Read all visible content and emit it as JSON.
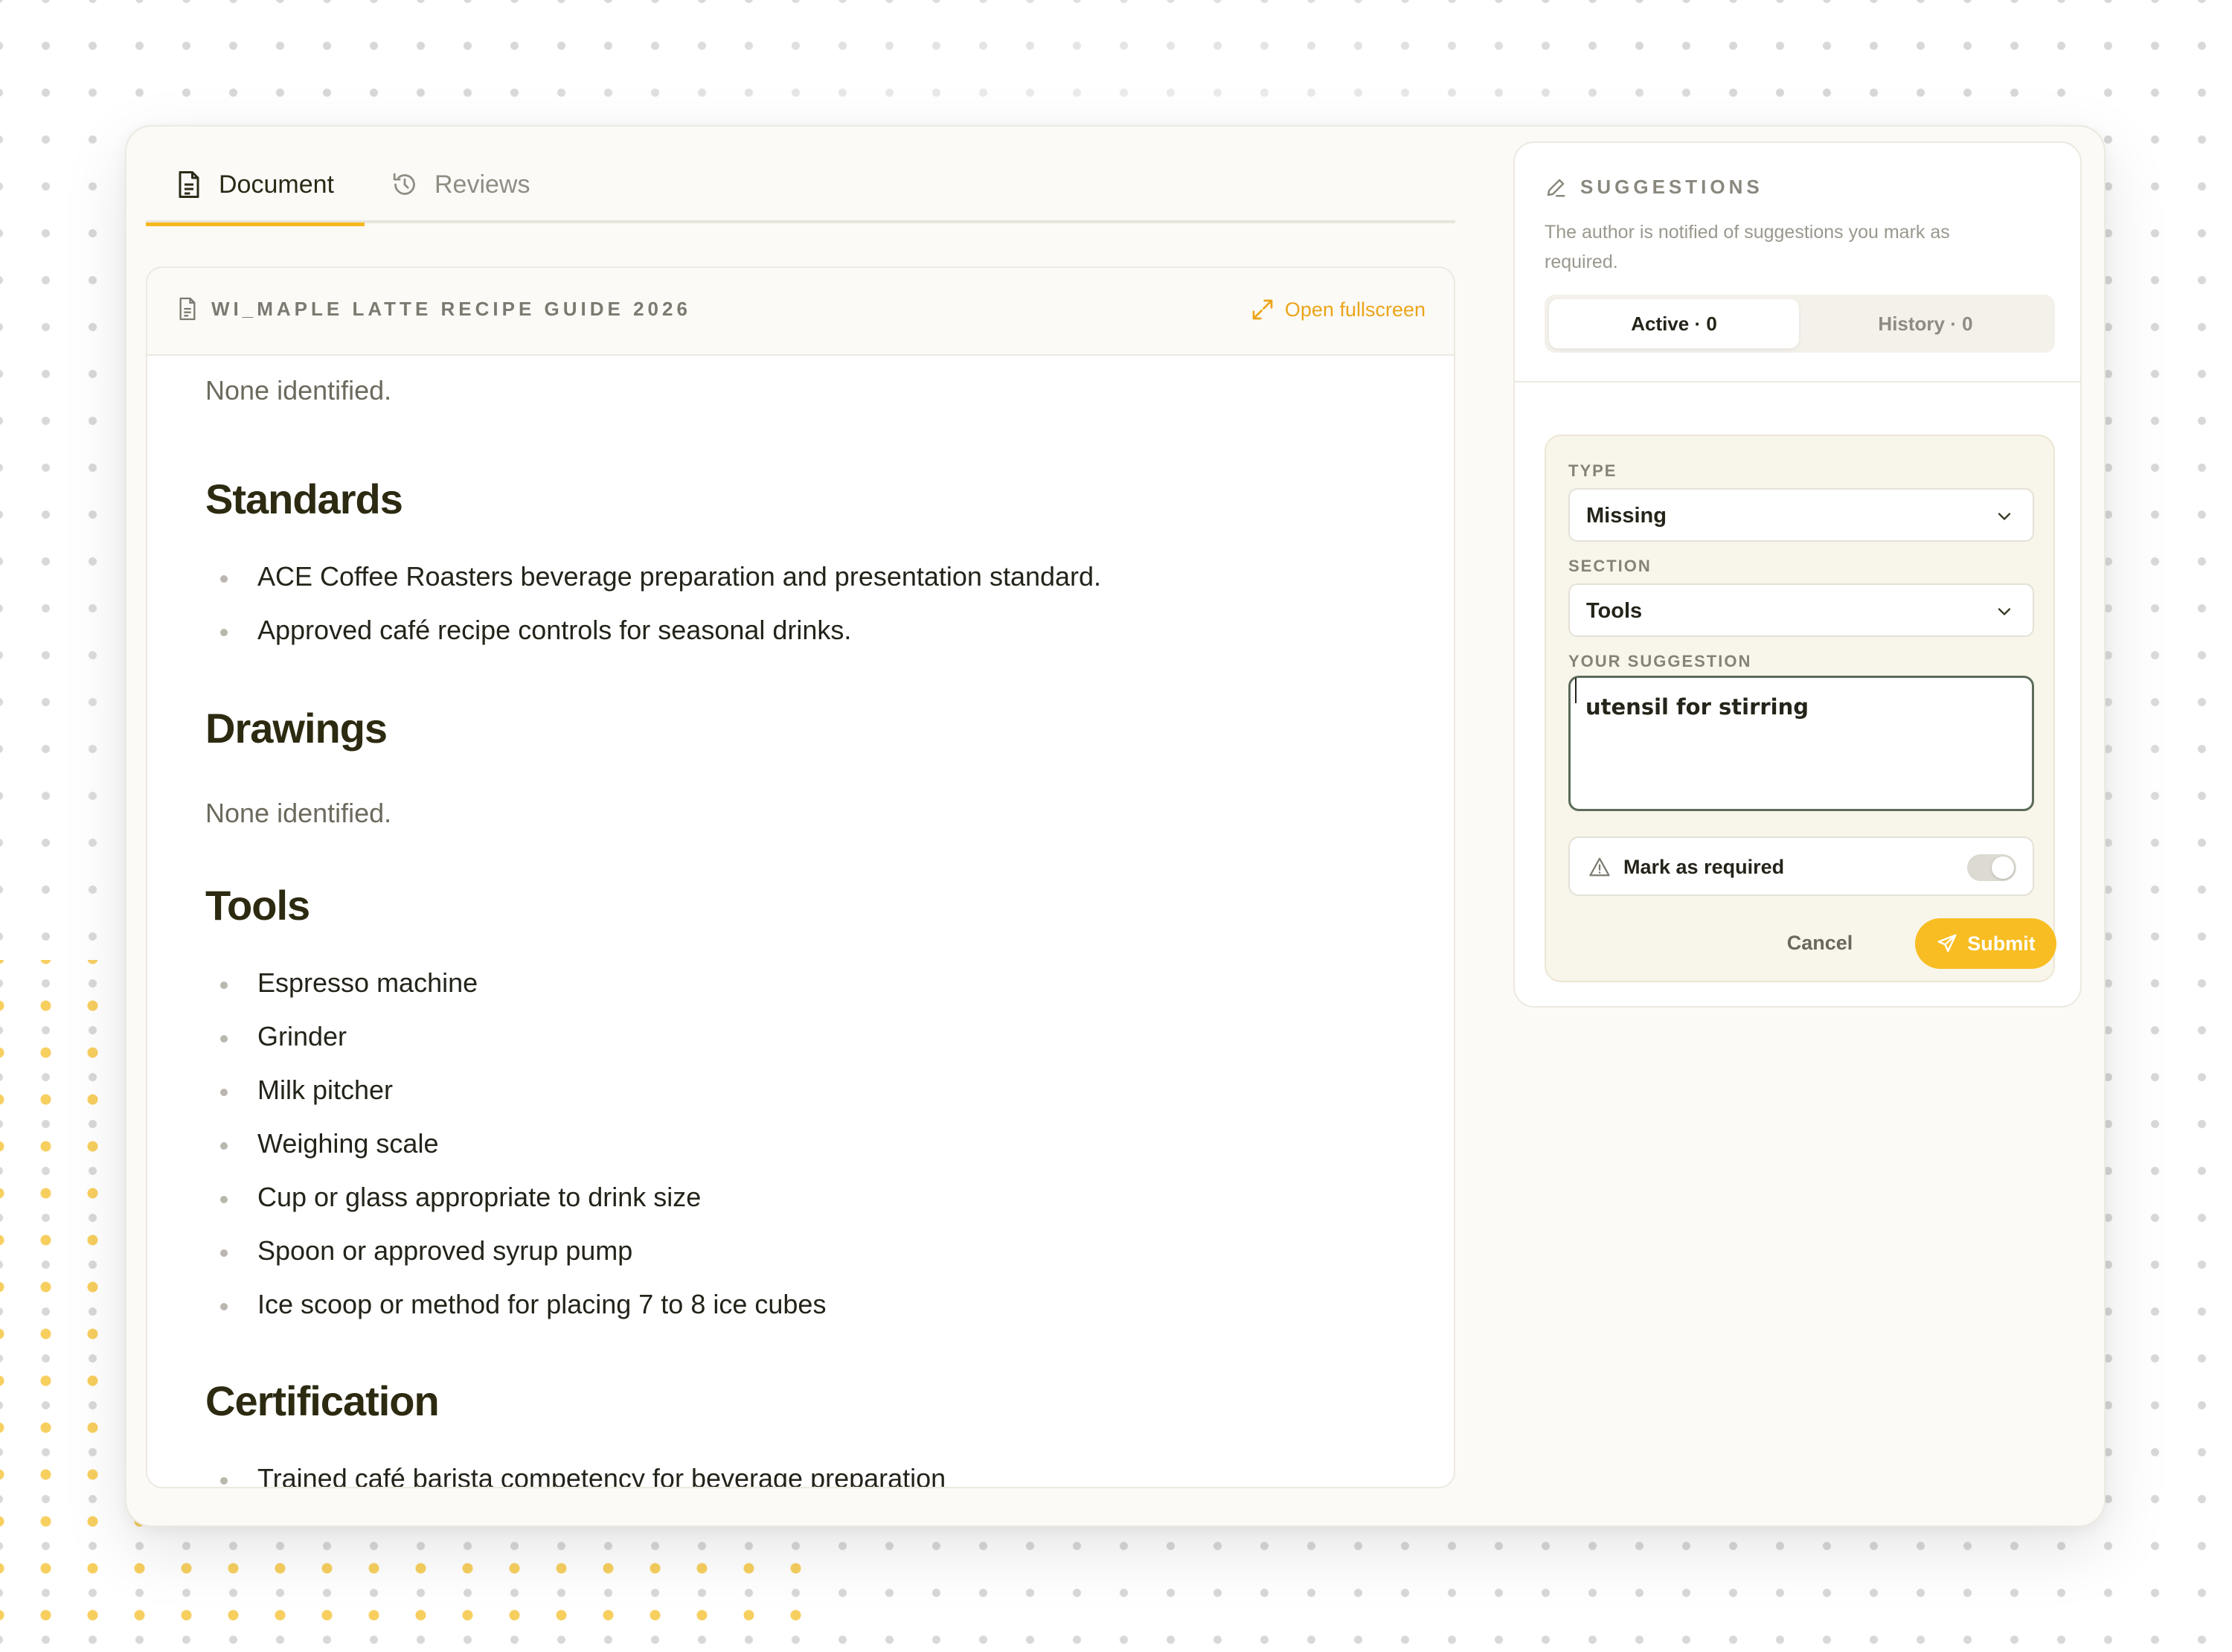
{
  "tabs": {
    "document": "Document",
    "reviews": "Reviews"
  },
  "document": {
    "title": "WI_MAPLE LATTE RECIPE GUIDE 2026",
    "open_fullscreen": "Open fullscreen",
    "intro": "None identified.",
    "standards": {
      "heading": "Standards",
      "items": [
        "ACE Coffee Roasters beverage preparation and presentation standard.",
        "Approved café recipe controls for seasonal drinks."
      ]
    },
    "drawings": {
      "heading": "Drawings",
      "text": "None identified."
    },
    "tools": {
      "heading": "Tools",
      "items": [
        "Espresso machine",
        "Grinder",
        "Milk pitcher",
        "Weighing scale",
        "Cup or glass appropriate to drink size",
        "Spoon or approved syrup pump",
        "Ice scoop or method for placing 7 to 8 ice cubes"
      ]
    },
    "certification": {
      "heading": "Certification",
      "items": [
        "Trained café barista competency for beverage preparation"
      ]
    }
  },
  "suggestions": {
    "title": "SUGGESTIONS",
    "description": "The author is notified of suggestions you mark as required.",
    "active_tab": "Active · 0",
    "history_tab": "History · 0",
    "form": {
      "type_label": "TYPE",
      "type_value": "Missing",
      "section_label": "SECTION",
      "section_value": "Tools",
      "suggestion_label": "YOUR SUGGESTION",
      "suggestion_value": "utensil for stirring ",
      "mark_required": "Mark as required",
      "mark_required_on": false,
      "cancel": "Cancel",
      "submit": "Submit"
    }
  },
  "colors": {
    "accent": "#f7bd22",
    "link": "#eba51a",
    "heading": "#2c2a10"
  }
}
